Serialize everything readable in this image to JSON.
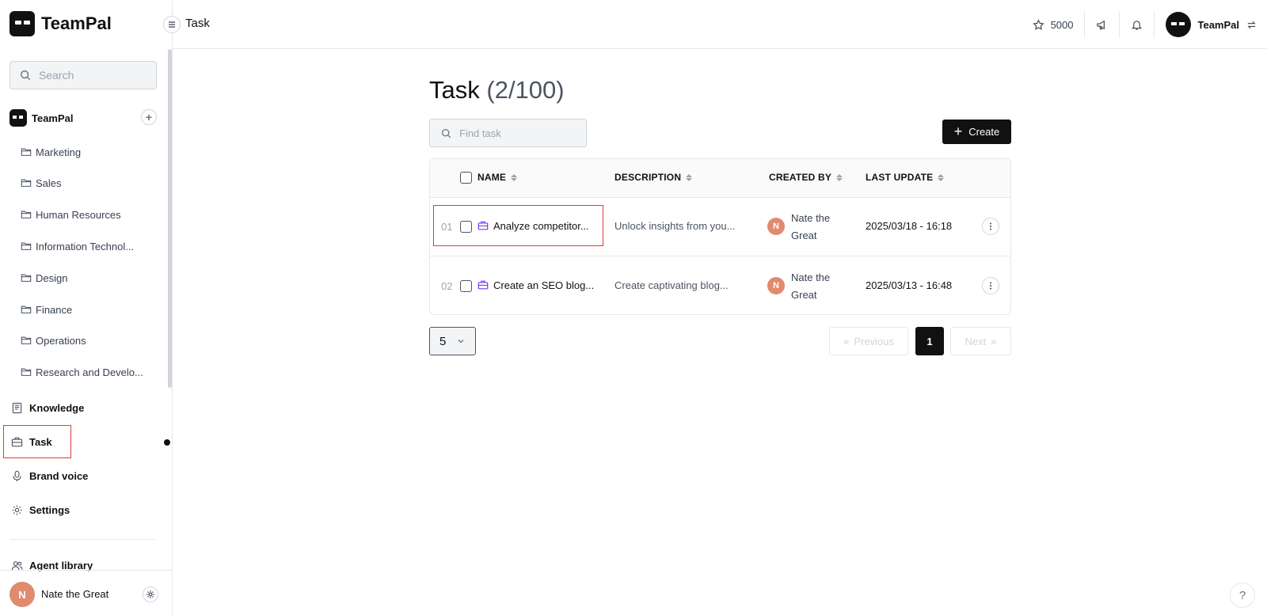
{
  "app": {
    "name": "TeamPal"
  },
  "header": {
    "breadcrumb": "Task",
    "credits": "5000",
    "account_name": "TeamPal"
  },
  "sidebar": {
    "search_placeholder": "Search",
    "workspace": {
      "name": "TeamPal"
    },
    "folders": [
      {
        "label": "Marketing"
      },
      {
        "label": "Sales"
      },
      {
        "label": "Human Resources"
      },
      {
        "label": "Information Technol..."
      },
      {
        "label": "Design"
      },
      {
        "label": "Finance"
      },
      {
        "label": "Operations"
      },
      {
        "label": "Research and Develo..."
      }
    ],
    "nav": [
      {
        "label": "Knowledge",
        "icon": "book-icon"
      },
      {
        "label": "Task",
        "icon": "briefcase-icon"
      },
      {
        "label": "Brand voice",
        "icon": "microphone-icon"
      },
      {
        "label": "Settings",
        "icon": "gear-icon"
      },
      {
        "label": "Agent library",
        "icon": "users-icon"
      }
    ],
    "user": {
      "initial": "N",
      "name": "Nate the Great"
    }
  },
  "main": {
    "title": "Task",
    "count": "(2/100)",
    "find_placeholder": "Find task",
    "create_label": "Create",
    "columns": [
      "NAME",
      "DESCRIPTION",
      "CREATED BY",
      "LAST UPDATE"
    ],
    "rows": [
      {
        "index": "01",
        "name": "Analyze competitor...",
        "description": "Unlock insights from you...",
        "creator_initial": "N",
        "creator_line1": "Nate the",
        "creator_line2": "Great",
        "updated": "2025/03/18 - 16:18"
      },
      {
        "index": "02",
        "name": "Create an SEO blog...",
        "description": "Create captivating blog...",
        "creator_initial": "N",
        "creator_line1": "Nate the",
        "creator_line2": "Great",
        "updated": "2025/03/13 - 16:48"
      }
    ],
    "page_size": "5",
    "pagination": {
      "previous": "Previous",
      "current": "1",
      "next": "Next"
    }
  },
  "help_label": "?",
  "colors": {
    "accent": "#111111",
    "avatar": "#e08a6e",
    "highlight": "#e53935",
    "task_icon": "#7c3aed"
  }
}
